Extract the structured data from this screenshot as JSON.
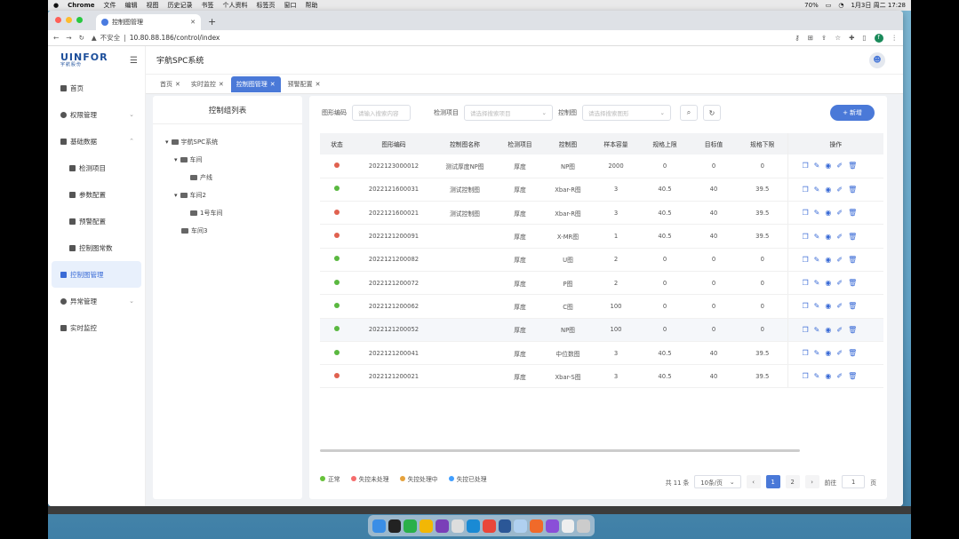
{
  "macos": {
    "app": "Chrome",
    "menus": [
      "文件",
      "编辑",
      "视图",
      "历史记录",
      "书签",
      "个人资料",
      "标签页",
      "窗口",
      "帮助"
    ],
    "battery": "70%",
    "clock": "1月3日 周二 17:28"
  },
  "browser": {
    "tab_title": "控制图管理",
    "security": "不安全",
    "url": "10.80.88.186/control/index",
    "avatar": "f"
  },
  "sidebar": {
    "brand": "UINFOR",
    "brand_sub": "宇航股份",
    "items": [
      {
        "label": "首页"
      },
      {
        "label": "权限管理"
      },
      {
        "label": "基础数据"
      },
      {
        "label": "检测项目"
      },
      {
        "label": "参数配置"
      },
      {
        "label": "预警配置"
      },
      {
        "label": "控制图常数"
      },
      {
        "label": "控制图管理"
      },
      {
        "label": "异常管理"
      },
      {
        "label": "实时监控"
      }
    ]
  },
  "header": {
    "title": "宇航SPC系统"
  },
  "page_tabs": [
    "首页",
    "实时监控",
    "控制图管理",
    "预警配置"
  ],
  "tree": {
    "title": "控制组列表",
    "nodes": [
      "宇航SPC系统",
      "车间",
      "产线",
      "车间2",
      "1号车间",
      "车间3"
    ]
  },
  "filters": {
    "code_label": "图形编码",
    "code_placeholder": "请输入搜索内容",
    "item_label": "检测项目",
    "item_placeholder": "请选择搜索项目",
    "chart_label": "控制图",
    "chart_placeholder": "请选择搜索图形",
    "add_label": "新增"
  },
  "table": {
    "headers": [
      "状态",
      "图形编码",
      "控制图名称",
      "检测项目",
      "控制图",
      "样本容量",
      "规格上限",
      "目标值",
      "规格下限",
      "操作"
    ],
    "rows": [
      {
        "status": "red",
        "code": "2022123000012",
        "name": "测试厚度NP图",
        "item": "厚度",
        "chart": "NP图",
        "n": "2000",
        "usl": "0",
        "target": "0",
        "lsl": "0"
      },
      {
        "status": "green",
        "code": "2022121600031",
        "name": "测试控制图",
        "item": "厚度",
        "chart": "Xbar-R图",
        "n": "3",
        "usl": "40.5",
        "target": "40",
        "lsl": "39.5"
      },
      {
        "status": "red",
        "code": "2022121600021",
        "name": "测试控制图",
        "item": "厚度",
        "chart": "Xbar-R图",
        "n": "3",
        "usl": "40.5",
        "target": "40",
        "lsl": "39.5"
      },
      {
        "status": "red",
        "code": "2022121200091",
        "name": "",
        "item": "厚度",
        "chart": "X-MR图",
        "n": "1",
        "usl": "40.5",
        "target": "40",
        "lsl": "39.5"
      },
      {
        "status": "green",
        "code": "2022121200082",
        "name": "",
        "item": "厚度",
        "chart": "U图",
        "n": "2",
        "usl": "0",
        "target": "0",
        "lsl": "0"
      },
      {
        "status": "green",
        "code": "2022121200072",
        "name": "",
        "item": "厚度",
        "chart": "P图",
        "n": "2",
        "usl": "0",
        "target": "0",
        "lsl": "0"
      },
      {
        "status": "green",
        "code": "2022121200062",
        "name": "",
        "item": "厚度",
        "chart": "C图",
        "n": "100",
        "usl": "0",
        "target": "0",
        "lsl": "0"
      },
      {
        "status": "green",
        "code": "2022121200052",
        "name": "",
        "item": "厚度",
        "chart": "NP图",
        "n": "100",
        "usl": "0",
        "target": "0",
        "lsl": "0"
      },
      {
        "status": "green",
        "code": "2022121200041",
        "name": "",
        "item": "厚度",
        "chart": "中位数图",
        "n": "3",
        "usl": "40.5",
        "target": "40",
        "lsl": "39.5"
      },
      {
        "status": "red",
        "code": "2022121200021",
        "name": "",
        "item": "厚度",
        "chart": "Xbar-S图",
        "n": "3",
        "usl": "40.5",
        "target": "40",
        "lsl": "39.5"
      }
    ]
  },
  "legend": [
    {
      "label": "正常",
      "color": "#67c23a"
    },
    {
      "label": "失控未处理",
      "color": "#f56c6c"
    },
    {
      "label": "失控处理中",
      "color": "#e6a23c"
    },
    {
      "label": "失控已处理",
      "color": "#409eff"
    }
  ],
  "pager": {
    "total": "共 11 条",
    "size": "10条/页",
    "pages": [
      "1",
      "2"
    ],
    "goto": "前往",
    "page_input": "1",
    "page_suffix": "页"
  },
  "colors": {
    "accent": "#4a79d8",
    "red": "#e0614f",
    "green": "#5ab840"
  }
}
